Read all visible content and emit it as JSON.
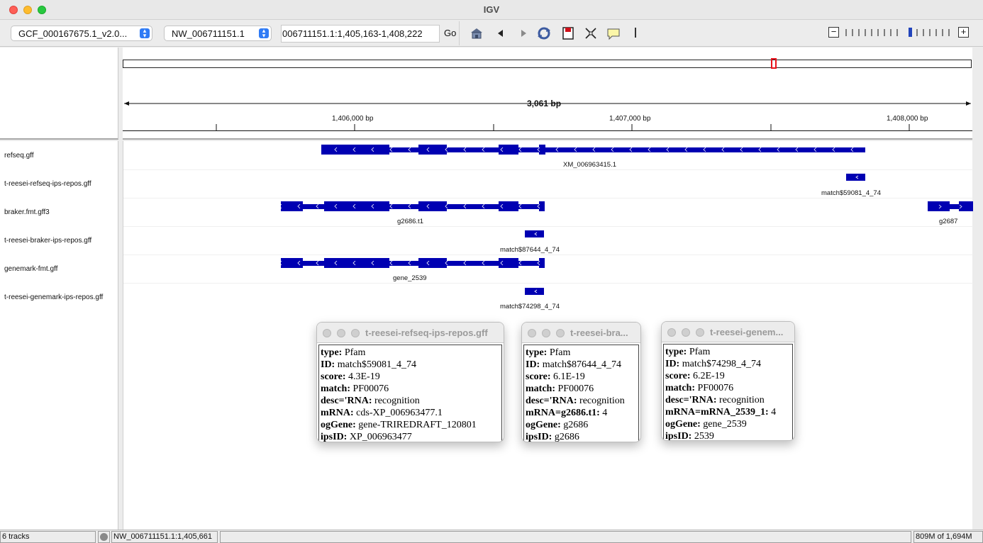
{
  "window": {
    "title": "IGV"
  },
  "toolbar": {
    "genome_select": "GCF_000167675.1_v2.0...",
    "chromosome_select": "NW_006711151.1",
    "locus_input": "006711151.1:1,405,163-1,408,222",
    "go_label": "Go",
    "icons": [
      "home-icon",
      "back-arrow-icon",
      "forward-arrow-icon",
      "refresh-icon",
      "region-of-interest-icon",
      "resize-to-window-icon",
      "popup-info-icon"
    ]
  },
  "ruler": {
    "span_label": "3,061 bp",
    "ticks": [
      "1,406,000 bp",
      "1,407,000 bp",
      "1,408,000 bp"
    ],
    "ideogram_marker_color": "#e8121b"
  },
  "tracks": [
    {
      "name": "refseq.gff",
      "feature_label": "XM_006963415.1"
    },
    {
      "name": "t-reesei-refseq-ips-repos.gff",
      "feature_label": "match$59081_4_74"
    },
    {
      "name": "braker.fmt.gff3",
      "feature_label": "g2686.t1",
      "feature_label_2": "g2687"
    },
    {
      "name": "t-reesei-braker-ips-repos.gff",
      "feature_label": "match$87644_4_74"
    },
    {
      "name": "genemark-fmt.gff",
      "feature_label": "gene_2539"
    },
    {
      "name": "t-reesei-genemark-ips-repos.gff",
      "feature_label": "match$74298_4_74"
    }
  ],
  "feature_color": "#0000b2",
  "popups": [
    {
      "title": "t-reesei-refseq-ips-repos.gff",
      "rows": [
        {
          "k": "type:",
          "v": " Pfam"
        },
        {
          "k": "ID:",
          "v": " match$59081_4_74"
        },
        {
          "k": "score:",
          "v": " 4.3E-19"
        },
        {
          "k": "match:",
          "v": " PF00076"
        },
        {
          "k": "desc='RNA:",
          "v": " recognition"
        },
        {
          "k": "mRNA:",
          "v": " cds-XP_006963477.1"
        },
        {
          "k": "ogGene:",
          "v": " gene-TRIREDRAFT_120801"
        },
        {
          "k": "ipsID:",
          "v": " XP_006963477"
        }
      ]
    },
    {
      "title": "t-reesei-bra...",
      "rows": [
        {
          "k": "type:",
          "v": " Pfam"
        },
        {
          "k": "ID:",
          "v": " match$87644_4_74"
        },
        {
          "k": "score:",
          "v": " 6.1E-19"
        },
        {
          "k": "match:",
          "v": " PF00076"
        },
        {
          "k": "desc='RNA:",
          "v": " recognition"
        },
        {
          "k": "mRNA=g2686.t1:",
          "v": " 4"
        },
        {
          "k": "ogGene:",
          "v": " g2686"
        },
        {
          "k": "ipsID:",
          "v": " g2686"
        }
      ]
    },
    {
      "title": "t-reesei-genem...",
      "rows": [
        {
          "k": "type:",
          "v": " Pfam"
        },
        {
          "k": "ID:",
          "v": " match$74298_4_74"
        },
        {
          "k": "score:",
          "v": " 6.2E-19"
        },
        {
          "k": "match:",
          "v": " PF00076"
        },
        {
          "k": "desc='RNA:",
          "v": " recognition"
        },
        {
          "k": "mRNA=mRNA_2539_1:",
          "v": " 4"
        },
        {
          "k": "ogGene:",
          "v": " gene_2539"
        },
        {
          "k": "ipsID:",
          "v": " 2539"
        }
      ]
    }
  ],
  "status": {
    "tracks": "6 tracks",
    "position": "NW_006711151.1:1,405,661",
    "memory": "809M of 1,694M"
  }
}
